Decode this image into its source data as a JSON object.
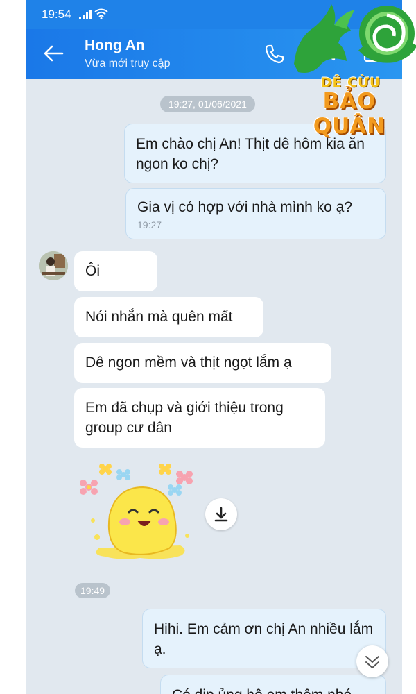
{
  "status_bar": {
    "time": "19:54"
  },
  "header": {
    "name": "Hong An",
    "status": "Vừa mới truy cập"
  },
  "chat": {
    "date_separator": "19:27, 01/06/2021",
    "outgoing_1": {
      "text": "Em chào chị An! Thịt dê hôm kia ăn ngon ko chị?"
    },
    "outgoing_2": {
      "text": "Gia vị có hợp với nhà mình ko ạ?",
      "time": "19:27"
    },
    "incoming": [
      {
        "text": "Ôi"
      },
      {
        "text": "Nói nhắn mà quên mất"
      },
      {
        "text": "Dê ngon mềm và thịt ngọt lắm ạ"
      },
      {
        "text": "Em đã chụp và giới thiệu trong group cư dân"
      }
    ],
    "sticker_time": "19:49",
    "outgoing_3": {
      "text": "Hihi. Em cảm ơn chị An nhiều lắm ạ."
    },
    "outgoing_4": {
      "text": "Có dịp ủng hộ em thêm nhé"
    }
  },
  "logo": {
    "line1": "DÊ CỪU",
    "line2": "BẢO QUÂN"
  },
  "colors": {
    "header_blue": "#1f82e8",
    "chat_bg": "#e1e8ef",
    "outgoing_bubble": "#e5f2fc"
  },
  "icons": [
    "back-arrow-icon",
    "phone-icon",
    "video-icon",
    "menu-icon",
    "download-icon",
    "chevron-down-icon"
  ]
}
